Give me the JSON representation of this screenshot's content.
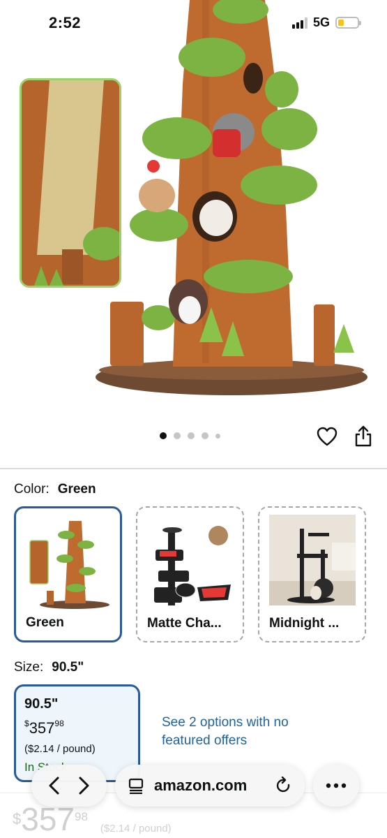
{
  "status_bar": {
    "time": "2:52",
    "network": "5G",
    "battery_level": 0.3,
    "signal_bars": 3,
    "signal_bars_total": 4
  },
  "gallery": {
    "image_count": 5,
    "active_index": 0
  },
  "colors": {
    "accent_blue": "#2b5a9a",
    "link_blue": "#2162a1",
    "in_stock_green": "#007600"
  },
  "color_selector": {
    "label": "Color:",
    "selected": "Green",
    "options": [
      {
        "label": "Green"
      },
      {
        "label": "Matte Cha..."
      },
      {
        "label": "Midnight ..."
      }
    ]
  },
  "size_selector": {
    "label": "Size:",
    "selected": "90.5\"",
    "option": {
      "size": "90.5\"",
      "currency": "$",
      "price_whole": "357",
      "price_fraction": "98",
      "per_unit": "($2.14 / pound)",
      "availability": "In Stock"
    },
    "other_options_text": "See 2 options with no featured offers"
  },
  "footer_price": {
    "currency": "$",
    "whole": "357",
    "fraction": "98",
    "per_unit": "($2.14 / pound)"
  },
  "browser": {
    "url": "amazon.com"
  },
  "icons": [
    "heart-icon",
    "share-icon",
    "back-icon",
    "forward-icon",
    "reader-icon",
    "reload-icon",
    "more-icon"
  ]
}
